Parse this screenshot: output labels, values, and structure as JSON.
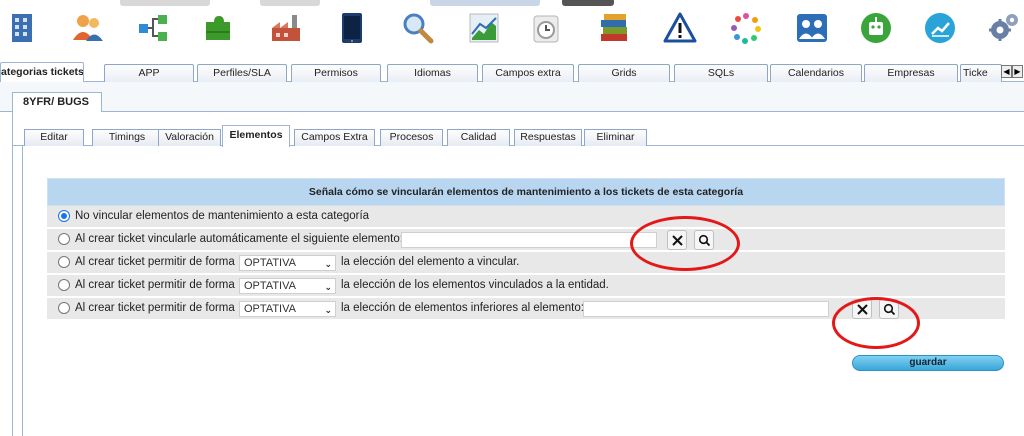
{
  "toolbar": {
    "icons": [
      {
        "name": "building-icon",
        "color": "#3b6fb0"
      },
      {
        "name": "users-icon",
        "color": "#e0662f"
      },
      {
        "name": "hierarchy-icon",
        "color": "#2f8ad8"
      },
      {
        "name": "puzzle-icon",
        "color": "#3c9a2b"
      },
      {
        "name": "factory-icon",
        "color": "#c2533a"
      },
      {
        "name": "tablet-icon",
        "color": "#1c3d6e"
      },
      {
        "name": "search-icon",
        "color": "#4b7fbf"
      },
      {
        "name": "chart-icon",
        "color": "#3b9b3b"
      },
      {
        "name": "clock-icon",
        "color": "#9a9a9a"
      },
      {
        "name": "books-icon",
        "color": "#7b9a2a"
      },
      {
        "name": "warning-icon",
        "color": "#1c4f9c"
      },
      {
        "name": "dots-icon",
        "color": "#e04fa0"
      },
      {
        "name": "team-icon",
        "color": "#2c6fb8"
      },
      {
        "name": "robot-icon",
        "color": "#3aa53a"
      },
      {
        "name": "trend-icon",
        "color": "#2aa3d8"
      },
      {
        "name": "gears-icon",
        "color": "#6a7fa5"
      }
    ]
  },
  "main_tabs": [
    {
      "label": "ategorias tickets",
      "active": true
    },
    {
      "label": "APP"
    },
    {
      "label": "Perfiles/SLA"
    },
    {
      "label": "Permisos"
    },
    {
      "label": "Idiomas"
    },
    {
      "label": "Campos extra"
    },
    {
      "label": "Grids"
    },
    {
      "label": "SQLs"
    },
    {
      "label": "Calendarios"
    },
    {
      "label": "Empresas"
    },
    {
      "label": "Ticke"
    }
  ],
  "subject_tab": {
    "label": "8YFR/ BUGS"
  },
  "sub_tabs": [
    {
      "label": "Editar"
    },
    {
      "label": "Timings"
    },
    {
      "label": "Valoración"
    },
    {
      "label": "Elementos",
      "active": true
    },
    {
      "label": "Campos Extra"
    },
    {
      "label": "Procesos"
    },
    {
      "label": "Calidad"
    },
    {
      "label": "Respuestas"
    },
    {
      "label": "Eliminar"
    }
  ],
  "panel": {
    "header": "Señala cómo se vincularán elementos de mantenimiento a los tickets de esta categoría",
    "options": [
      {
        "text": "No vincular elementos de mantenimiento a esta categoría",
        "checked": true
      },
      {
        "text": "Al crear ticket vincularle automáticamente el siguiente elemento:",
        "field_value": ""
      },
      {
        "prefix": "Al crear ticket permitir de forma",
        "select_value": "OPTATIVA",
        "suffix": "la elección del elemento a vincular."
      },
      {
        "prefix": "Al crear ticket permitir de forma",
        "select_value": "OPTATIVA",
        "suffix": "la elección de los elementos vinculados a la entidad."
      },
      {
        "prefix": "Al crear ticket permitir de forma",
        "select_value": "OPTATIVA",
        "suffix": "la elección de elementos inferiores al elemento:",
        "field_value": ""
      }
    ]
  },
  "save_button": {
    "label": "guardar"
  },
  "colors": {
    "header_bg": "#b8d6ef",
    "row_bg": "#e8e8e8",
    "highlight": "#e31818",
    "save_button": "#3aa7d8"
  }
}
